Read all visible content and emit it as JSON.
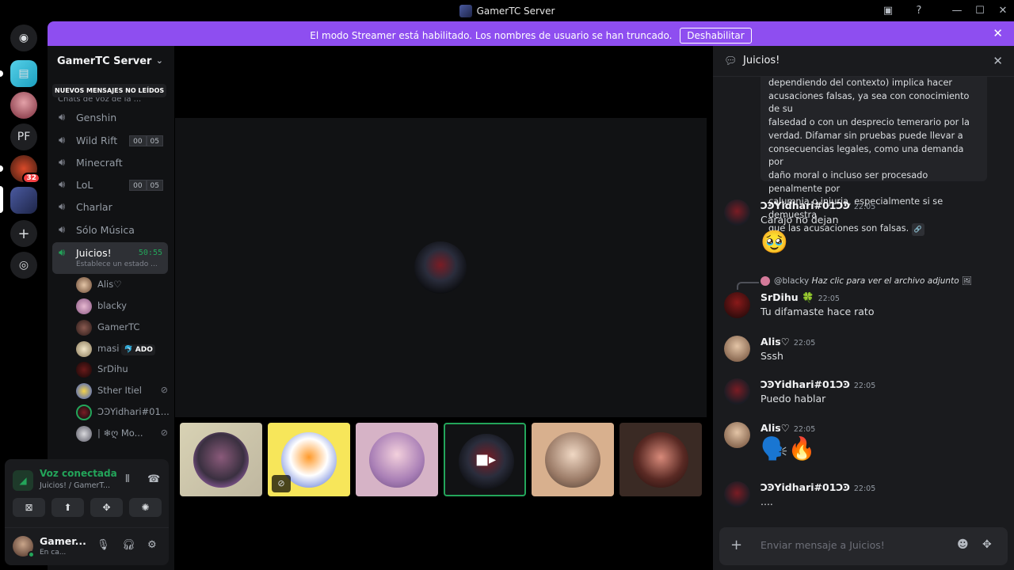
{
  "window": {
    "title": "GamerTC Server"
  },
  "streamer_banner": {
    "message": "El modo Streamer está habilitado. Los nombres de usuario se han truncado.",
    "disable_label": "Deshabilitar"
  },
  "rail": {
    "pf_label": "PF",
    "mention_count": "32"
  },
  "sidebar": {
    "server_name": "GamerTC Server",
    "unread_pill": "NUEVOS MENSAJES NO LEÍDOS",
    "category_ghost": "Chats de voz de la ...",
    "channels": [
      {
        "name": "Genshin"
      },
      {
        "name": "Wild Rift",
        "counts": [
          "00",
          "05"
        ]
      },
      {
        "name": "Minecraft"
      },
      {
        "name": "LoL",
        "counts": [
          "00",
          "05"
        ]
      },
      {
        "name": "Charlar"
      },
      {
        "name": "Sólo Música"
      }
    ],
    "active_channel": {
      "name": "Juicios!",
      "timer": "50:55",
      "status": "Establece un estado ..."
    },
    "members": [
      {
        "name": "Alis♡"
      },
      {
        "name": "blacky"
      },
      {
        "name": "GamerTC"
      },
      {
        "name": "masi",
        "badge": "ADO"
      },
      {
        "name": "SrDihu"
      },
      {
        "name": "Sther Itiel"
      },
      {
        "name": "ϽϿYidhari#01..."
      },
      {
        "name": "| ❄ღ Mo..."
      }
    ]
  },
  "voice_panel": {
    "title": "Voz conectada",
    "subtitle": "Juicios! / GamerT...",
    "user_name": "Gamer...",
    "user_status": "En ca..."
  },
  "chat": {
    "title": "Juicios!",
    "embed_lines": [
      "dependiendo del contexto) implica hacer",
      "acusaciones falsas, ya sea con conocimiento de su",
      "falsedad o con un desprecio temerario por la",
      "verdad. Difamar sin pruebas puede llevar a",
      "consecuencias legales, como una demanda por",
      "daño moral o incluso ser procesado penalmente por",
      "calumnia o injuria, especialmente si se demuestra",
      "que las acusaciones son falsas."
    ],
    "messages": [
      {
        "author": "ϽϿYidhari#01ϽϿ",
        "time": "22:05",
        "text": "Carajo no dejan",
        "emoji": "🥹"
      },
      {
        "reply_user": "@blacky",
        "reply_text": "Haz clic para ver el archivo adjunto",
        "author": "SrDihu",
        "author_badge": "🍀",
        "time": "22:05",
        "text": "Tu difamaste hace rato"
      },
      {
        "author": "Alis♡",
        "time": "22:05",
        "text": "Sssh"
      },
      {
        "author": "ϽϿYidhari#01ϽϿ",
        "time": "22:05",
        "text": "Puedo hablar"
      },
      {
        "author": "Alis♡",
        "time": "22:05",
        "emoji": "🗣️🔥"
      },
      {
        "author": "ϽϿYidhari#01ϽϿ",
        "time": "22:05",
        "text": "...."
      }
    ],
    "composer_placeholder": "Enviar mensaje a Juicios!"
  },
  "colors": {
    "accent": "#8e4ef0",
    "online": "#23a55a",
    "background": "#000000",
    "sidebar": "#111214"
  }
}
